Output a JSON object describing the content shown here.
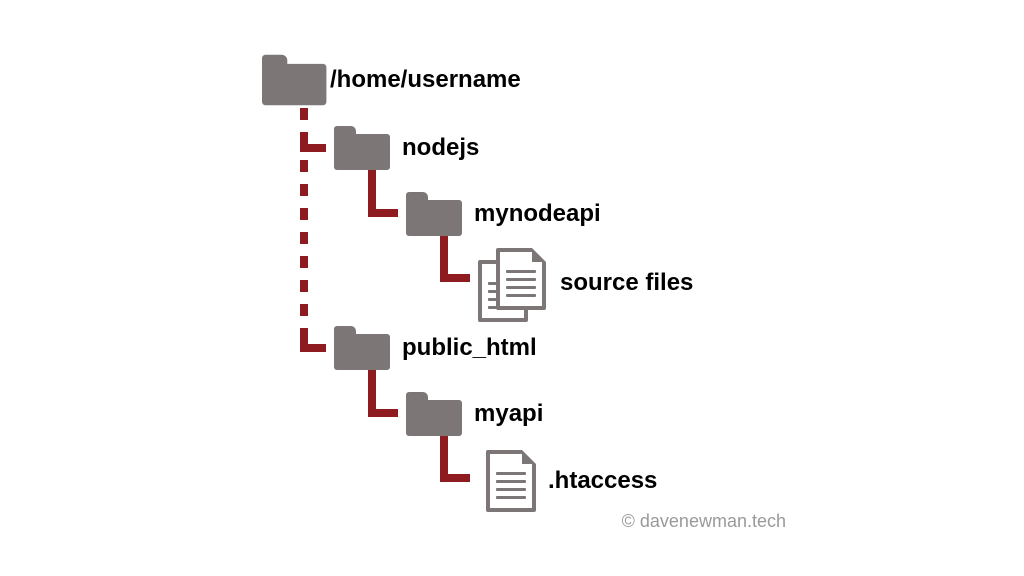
{
  "colors": {
    "folder": "#7d7676",
    "connector": "#8e1b1f"
  },
  "tree": {
    "root": {
      "label": "/home/username"
    },
    "nodejs": {
      "label": "nodejs"
    },
    "mynodeapi": {
      "label": "mynodeapi"
    },
    "sourcefiles": {
      "label": "source files"
    },
    "public_html": {
      "label": "public_html"
    },
    "myapi": {
      "label": "myapi"
    },
    "htaccess": {
      "label": ".htaccess"
    }
  },
  "credit": "© davenewman.tech"
}
